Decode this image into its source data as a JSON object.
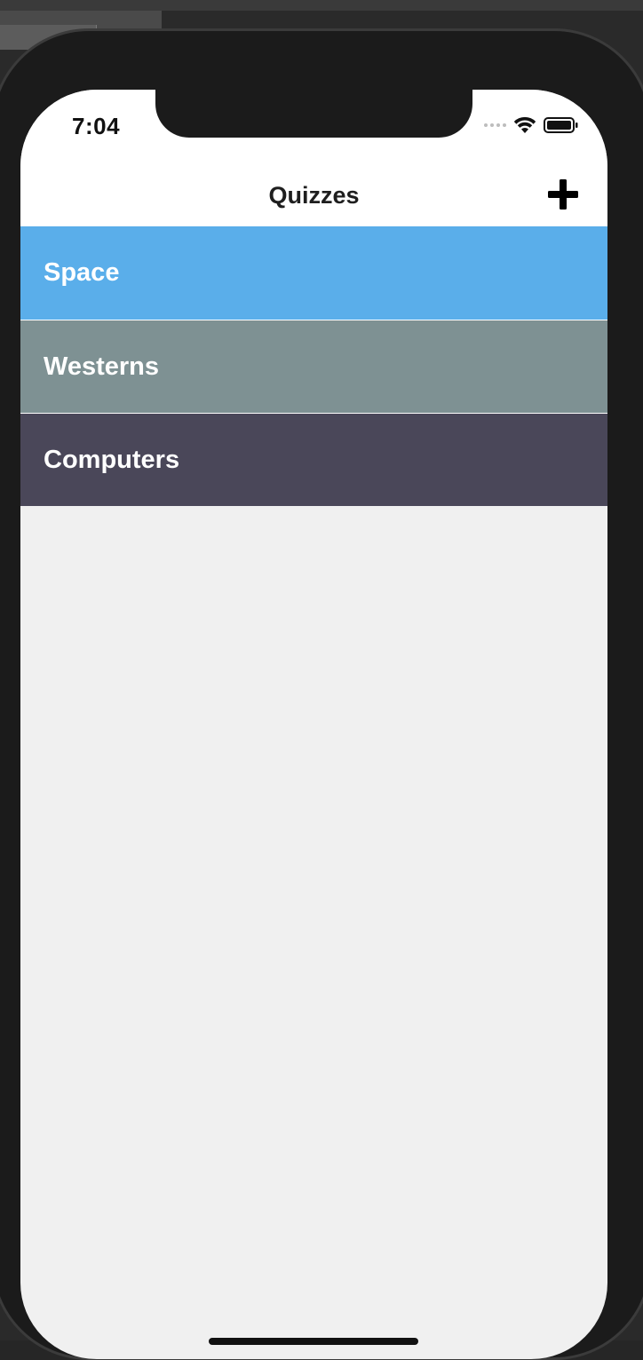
{
  "status_bar": {
    "time": "7:04",
    "icons": [
      "cellular-dots-icon",
      "wifi-icon",
      "battery-icon"
    ]
  },
  "nav": {
    "title": "Quizzes",
    "add_icon": "plus-icon"
  },
  "quizzes": [
    {
      "label": "Space",
      "color": "#5aaeea"
    },
    {
      "label": "Westerns",
      "color": "#7e9193"
    },
    {
      "label": "Computers",
      "color": "#4a4759"
    }
  ],
  "colors": {
    "screen_background": "#f0f0f0",
    "bar_background": "#ffffff",
    "device_frame": "#1b1b1b"
  }
}
